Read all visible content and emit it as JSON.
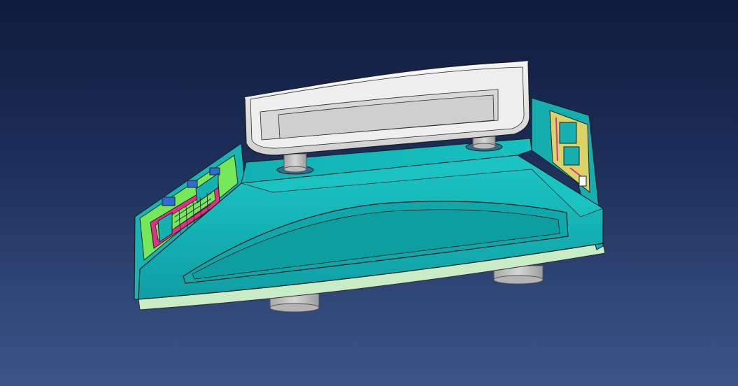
{
  "viewport": {
    "background_top": "#0f1b3c",
    "background_bottom": "#3b5587"
  },
  "model": {
    "subject": "weighing-scale-cad-model",
    "colors": {
      "body": "#16b9b9",
      "body_shade": "#0ea3a6",
      "body_dark": "#0b8d92",
      "base_strip": "#c9ecc6",
      "pan": "#e6e6e6",
      "pan_shade": "#c6c6c6",
      "feet": "#bdbdbd",
      "panel_green": "#73e85a",
      "panel_magenta": "#e0308a",
      "edge": "#1b1b1b"
    }
  }
}
